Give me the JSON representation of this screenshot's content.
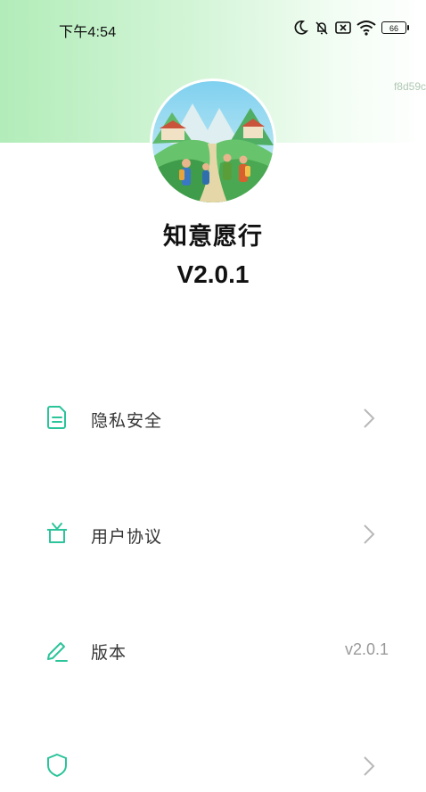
{
  "status_bar": {
    "time": "下午4:54",
    "battery": "66",
    "icons": [
      "moon-icon",
      "bell-off-icon",
      "sim-off-icon",
      "wifi-icon",
      "battery-icon"
    ]
  },
  "debug_label": "f8d59c",
  "app": {
    "name": "知意愿行",
    "version": "V2.0.1"
  },
  "menu": [
    {
      "label": "隐私安全",
      "icon": "document-icon",
      "accessory": "chevron"
    },
    {
      "label": "用户协议",
      "icon": "gift-box-icon",
      "accessory": "chevron"
    },
    {
      "label": "版本",
      "icon": "pencil-icon",
      "value": "v2.0.1"
    },
    {
      "label": "",
      "icon": "shield-icon",
      "accessory": "chevron"
    }
  ],
  "colors": {
    "accent": "#2cc49a",
    "header_green": "#b2ecb9"
  }
}
